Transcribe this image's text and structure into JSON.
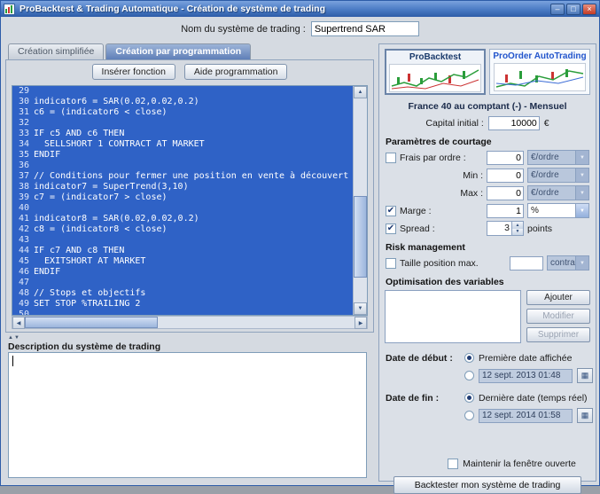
{
  "window": {
    "title": "ProBacktest & Trading Automatique - Création de système de trading",
    "controls": {
      "minimize": "–",
      "maximize": "□",
      "close": "×"
    }
  },
  "name_row": {
    "label": "Nom du système de trading :",
    "value": "Supertrend SAR"
  },
  "tabs": [
    {
      "label": "Création simplifiée"
    },
    {
      "label": "Création par programmation"
    }
  ],
  "toolbar": {
    "insert_function": "Insérer fonction",
    "programming_help": "Aide programmation"
  },
  "code": {
    "lines": [
      {
        "num": "29",
        "text": ""
      },
      {
        "num": "30",
        "text": "indicator6 = SAR(0.02,0.02,0.2)"
      },
      {
        "num": "31",
        "text": "c6 = (indicator6 < close)"
      },
      {
        "num": "32",
        "text": ""
      },
      {
        "num": "33",
        "text": "IF c5 AND c6 THEN"
      },
      {
        "num": "34",
        "text": "  SELLSHORT 1 CONTRACT AT MARKET"
      },
      {
        "num": "35",
        "text": "ENDIF"
      },
      {
        "num": "36",
        "text": ""
      },
      {
        "num": "37",
        "text": "// Conditions pour fermer une position en vente à découvert"
      },
      {
        "num": "38",
        "text": "indicator7 = SuperTrend(3,10)"
      },
      {
        "num": "39",
        "text": "c7 = (indicator7 > close)"
      },
      {
        "num": "40",
        "text": ""
      },
      {
        "num": "41",
        "text": "indicator8 = SAR(0.02,0.02,0.2)"
      },
      {
        "num": "42",
        "text": "c8 = (indicator8 < close)"
      },
      {
        "num": "43",
        "text": ""
      },
      {
        "num": "44",
        "text": "IF c7 AND c8 THEN"
      },
      {
        "num": "45",
        "text": "  EXITSHORT AT MARKET"
      },
      {
        "num": "46",
        "text": "ENDIF"
      },
      {
        "num": "47",
        "text": ""
      },
      {
        "num": "48",
        "text": "// Stops et objectifs"
      },
      {
        "num": "49",
        "text": "SET STOP %TRAILING 2"
      },
      {
        "num": "50",
        "text": ""
      }
    ]
  },
  "description": {
    "label": "Description du système de trading",
    "value": ""
  },
  "right": {
    "products": [
      {
        "label": "ProBacktest"
      },
      {
        "label": "ProOrder AutoTrading"
      }
    ],
    "instrument": "France 40 au comptant (-) - Mensuel",
    "capital": {
      "label": "Capital initial :",
      "value": "10000",
      "currency": "€"
    },
    "courtage": {
      "title": "Paramètres de courtage",
      "fees_label": "Frais par ordre :",
      "fees_value": "0",
      "fees_unit": "€/ordre",
      "min_label": "Min :",
      "min_value": "0",
      "min_unit": "€/ordre",
      "max_label": "Max :",
      "max_value": "0",
      "max_unit": "€/ordre",
      "margin_label": "Marge :",
      "margin_value": "1",
      "margin_unit": "%",
      "spread_label": "Spread :",
      "spread_value": "3",
      "spread_unit": "points"
    },
    "risk": {
      "title": "Risk management",
      "position_label": "Taille position max.",
      "position_value": "",
      "position_unit": "contrats"
    },
    "optimisation": {
      "title": "Optimisation des variables",
      "add": "Ajouter",
      "edit": "Modifier",
      "delete": "Supprimer"
    },
    "dates": {
      "start_label": "Date de début :",
      "start_option1": "Première date affichée",
      "start_value": "12 sept. 2013 01:48",
      "end_label": "Date de fin :",
      "end_option1": "Dernière date (temps réel)",
      "end_value": "12 sept. 2014 01:58"
    },
    "keep_open_label": "Maintenir la fenêtre ouverte",
    "backtest_button": "Backtester mon système de trading"
  }
}
